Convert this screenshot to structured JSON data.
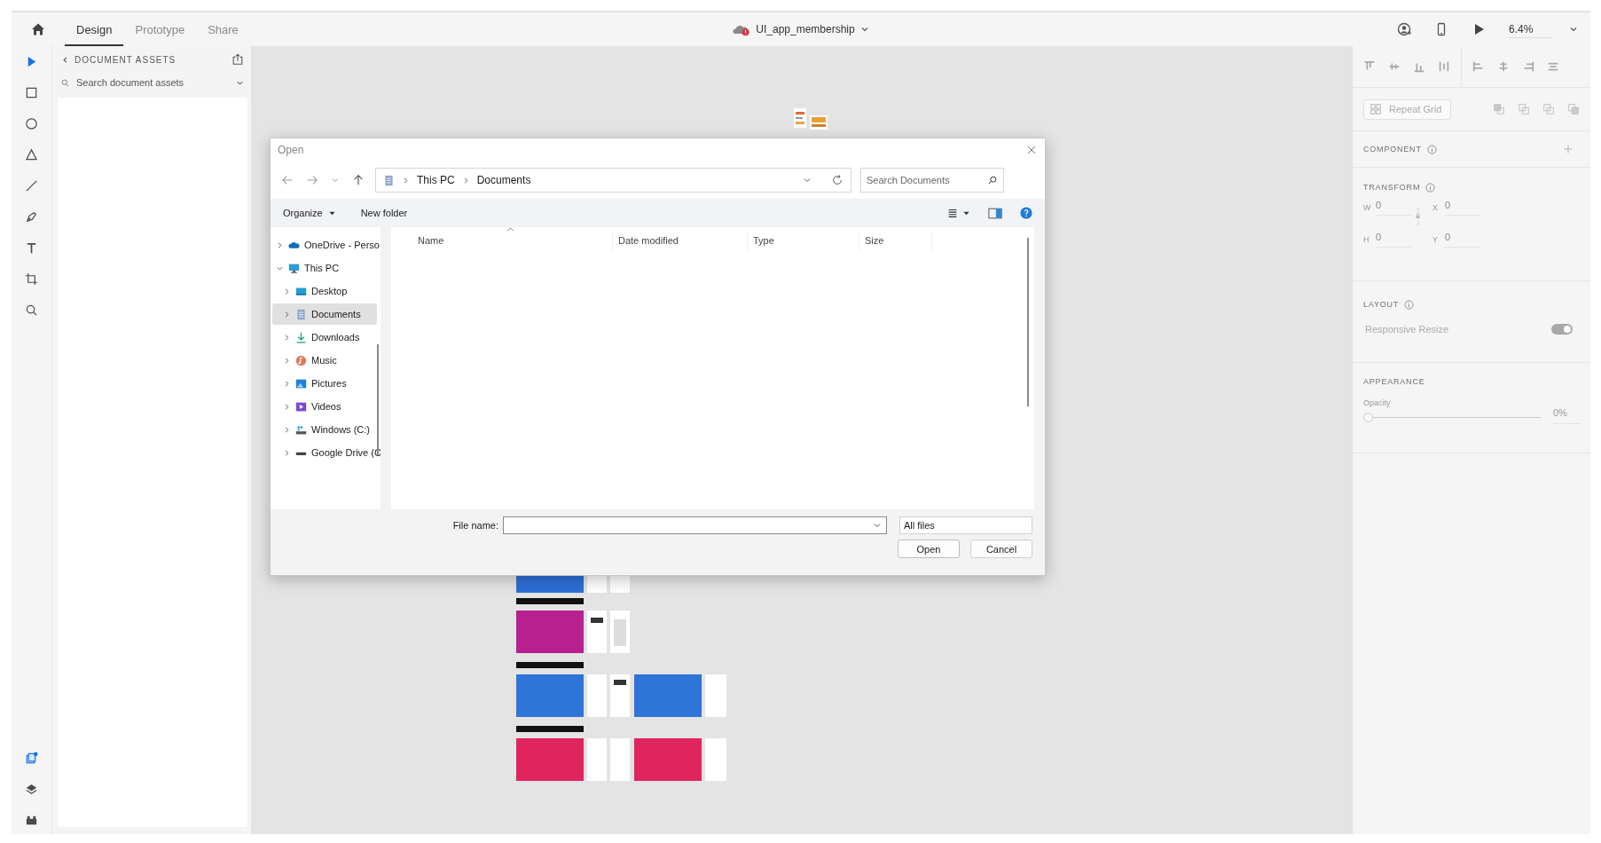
{
  "app_bar": {
    "tabs": [
      {
        "label": "Design",
        "selected": true
      },
      {
        "label": "Prototype",
        "selected": false
      },
      {
        "label": "Share",
        "selected": false
      }
    ],
    "document_title": "UI_app_membership",
    "zoom": "6.4%"
  },
  "tools": [
    {
      "kind": "select",
      "selected": true
    },
    {
      "kind": "rectangle",
      "selected": false
    },
    {
      "kind": "ellipse",
      "selected": false
    },
    {
      "kind": "polygon",
      "selected": false
    },
    {
      "kind": "line",
      "selected": false
    },
    {
      "kind": "pen",
      "selected": false
    },
    {
      "kind": "text",
      "selected": false
    },
    {
      "kind": "artboard",
      "selected": false
    },
    {
      "kind": "zoom",
      "selected": false
    }
  ],
  "panel_tabs": [
    {
      "kind": "assets",
      "selected": true
    },
    {
      "kind": "layers",
      "selected": false
    },
    {
      "kind": "plugins",
      "selected": false
    }
  ],
  "assets_panel": {
    "title": "DOCUMENT ASSETS",
    "search_placeholder": "Search document assets"
  },
  "dialog": {
    "title": "Open",
    "path": [
      "This PC",
      "Documents"
    ],
    "search_placeholder": "Search Documents",
    "organize": "Organize",
    "new_folder": "New folder",
    "columns": [
      "Name",
      "Date modified",
      "Type",
      "Size"
    ],
    "nav": [
      {
        "label": "OneDrive - Perso",
        "kind": "cloud",
        "expanded": false,
        "selected": false
      },
      {
        "label": "This PC",
        "kind": "computer",
        "expanded": true,
        "selected": false,
        "children": [
          {
            "label": "Desktop",
            "kind": "desktop",
            "expanded": false,
            "selected": false
          },
          {
            "label": "Documents",
            "kind": "documents",
            "expanded": false,
            "selected": true
          },
          {
            "label": "Downloads",
            "kind": "downloads",
            "expanded": false,
            "selected": false
          },
          {
            "label": "Music",
            "kind": "music",
            "expanded": false,
            "selected": false
          },
          {
            "label": "Pictures",
            "kind": "pictures",
            "expanded": false,
            "selected": false
          },
          {
            "label": "Videos",
            "kind": "videos",
            "expanded": false,
            "selected": false
          },
          {
            "label": "Windows (C:)",
            "kind": "system-drive",
            "expanded": false,
            "selected": false
          },
          {
            "label": "Google Drive (C",
            "kind": "drive",
            "expanded": false,
            "selected": false
          }
        ]
      }
    ],
    "file_name_label": "File name:",
    "file_type": "All files",
    "buttons": [
      "Open",
      "Cancel"
    ]
  },
  "properties": {
    "repeat_grid": "Repeat Grid",
    "component": "COMPONENT",
    "transform": "TRANSFORM",
    "fields": [
      {
        "label": "W",
        "value": "0"
      },
      {
        "label": "X",
        "value": "0"
      },
      {
        "label": "H",
        "value": "0"
      },
      {
        "label": "Y",
        "value": "0"
      }
    ],
    "layout": "LAYOUT",
    "responsive_resize": {
      "label": "Responsive Resize",
      "on": true
    },
    "appearance": "APPEARANCE",
    "opacity": {
      "label": "Opacity",
      "level": 0,
      "reading": "0%"
    }
  }
}
